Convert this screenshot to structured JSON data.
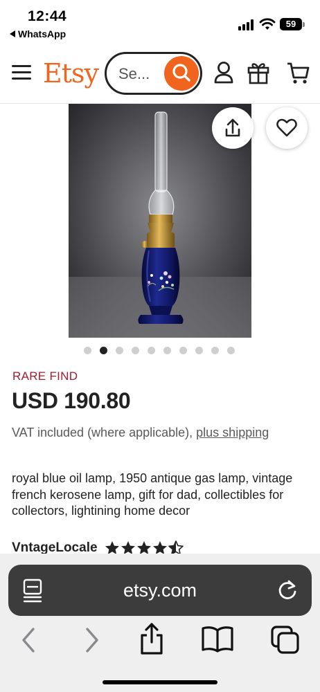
{
  "status_bar": {
    "time": "12:44",
    "back_app": "WhatsApp",
    "battery_level": "59"
  },
  "header": {
    "logo": "Etsy",
    "search_placeholder": "Se...",
    "accent_color": "#F1641E",
    "icons": [
      "menu-icon",
      "search-icon",
      "account-icon",
      "gift-icon",
      "cart-icon"
    ]
  },
  "gallery": {
    "image_count": 10,
    "active_index": 1,
    "share_icon": "share-icon",
    "favorite_icon": "heart-icon"
  },
  "product": {
    "badge": "RARE FIND",
    "badge_color": "#A61A2E",
    "price": "USD 190.80",
    "vat_text": "VAT included (where applicable), ",
    "shipping_link": "plus shipping",
    "title": "royal blue oil lamp, 1950 antique gas lamp, vintage french kerosene lamp, gift for dad, collectibles for collectors, lightining home decor",
    "shop_name": "VntageLocale",
    "rating": 4.5
  },
  "browser": {
    "url": "etsy.com",
    "toolbar": [
      "tabs-overview-icon",
      "reload-icon",
      "back-icon",
      "forward-icon",
      "share-icon",
      "bookmarks-icon",
      "tabs-icon"
    ]
  }
}
